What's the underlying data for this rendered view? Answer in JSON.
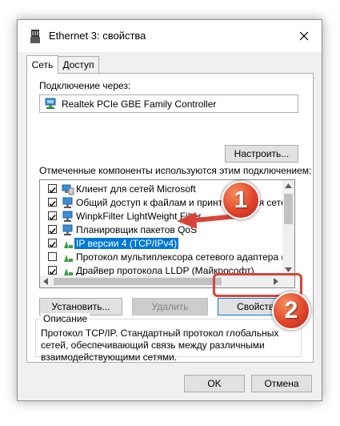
{
  "window": {
    "title": "Ethernet 3: свойства"
  },
  "tabs": [
    {
      "label": "Сеть",
      "active": true
    },
    {
      "label": "Доступ",
      "active": false
    }
  ],
  "connection": {
    "label": "Подключение через:",
    "adapter": "Realtek PCIe GBE Family Controller",
    "configure_button": "Настроить..."
  },
  "components": {
    "label": "Отмеченные компоненты используются этим подключением:",
    "items": [
      {
        "text": "Клиент для сетей Microsoft",
        "checked": true,
        "icon": "network-client-icon",
        "selected": false
      },
      {
        "text": "Общий доступ к файлам и принтерам для сетей Mi",
        "checked": true,
        "icon": "network-service-icon",
        "selected": false
      },
      {
        "text": "WinpkFilter LightWeight Filter",
        "checked": true,
        "icon": "network-service-icon",
        "selected": false
      },
      {
        "text": "Планировщик пакетов QoS",
        "checked": true,
        "icon": "network-service-icon",
        "selected": false
      },
      {
        "text": "IP версии 4 (TCP/IPv4)",
        "checked": true,
        "icon": "protocol-icon",
        "selected": true
      },
      {
        "text": "Протокол мультиплексора сетевого адаптера (Майк",
        "checked": false,
        "icon": "protocol-icon",
        "selected": false
      },
      {
        "text": "Драйвер протокола LLDP (Майкрософт)",
        "checked": true,
        "icon": "protocol-icon",
        "selected": false
      }
    ]
  },
  "actions": {
    "install": "Установить...",
    "remove": "Удалить",
    "properties": "Свойства"
  },
  "description": {
    "title": "Описание",
    "text": "Протокол TCP/IP. Стандартный протокол глобальных сетей, обеспечивающий связь между различными взаимодействующими сетями."
  },
  "footer": {
    "ok": "OK",
    "cancel": "Отмена"
  },
  "annotations": {
    "badge1": "1",
    "badge2": "2",
    "color": "#e2452b"
  },
  "colors": {
    "selection": "#0078d7",
    "window_bg": "#f0f0f0"
  }
}
